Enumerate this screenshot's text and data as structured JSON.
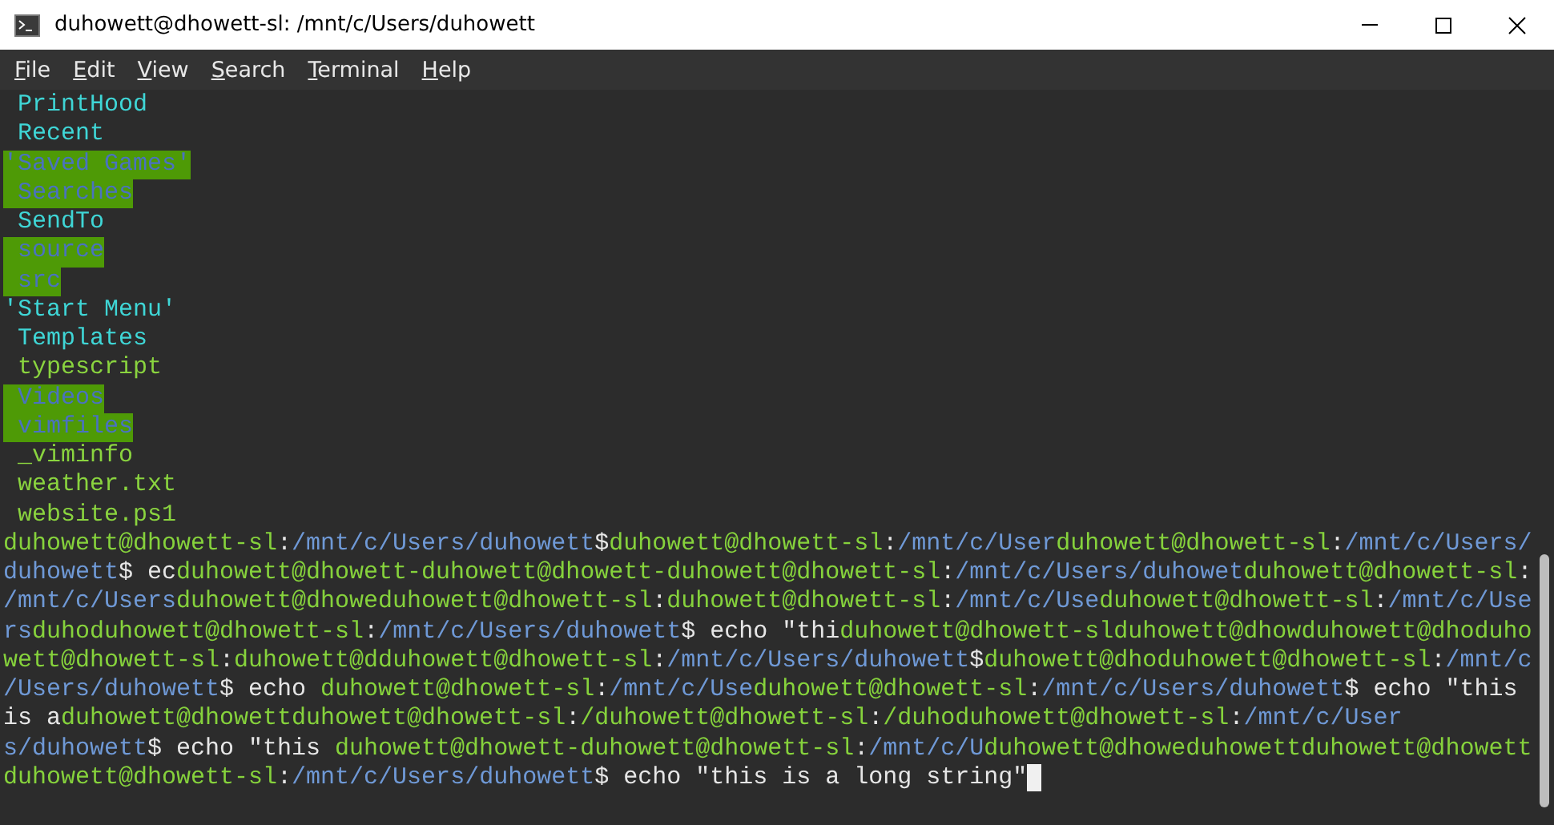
{
  "window": {
    "title": "duhowett@dhowett-sl: /mnt/c/Users/duhowett"
  },
  "menu": [
    {
      "label": "File"
    },
    {
      "label": "Edit"
    },
    {
      "label": "View"
    },
    {
      "label": "Search"
    },
    {
      "label": "Terminal"
    },
    {
      "label": "Help"
    }
  ],
  "listing": [
    {
      "text": " PrintHood",
      "kind": "dir"
    },
    {
      "text": " Recent",
      "kind": "dir"
    },
    {
      "text": "'Saved Games'",
      "kind": "sticky"
    },
    {
      "text": " Searches",
      "kind": "sticky"
    },
    {
      "text": " SendTo",
      "kind": "dir"
    },
    {
      "text": " source",
      "kind": "sticky"
    },
    {
      "text": " src",
      "kind": "sticky"
    },
    {
      "text": "'Start Menu'",
      "kind": "dir"
    },
    {
      "text": " Templates",
      "kind": "dir"
    },
    {
      "text": " typescript",
      "kind": "file"
    },
    {
      "text": " Videos",
      "kind": "sticky"
    },
    {
      "text": " vimfiles",
      "kind": "sticky"
    },
    {
      "text": " _viminfo",
      "kind": "file"
    },
    {
      "text": " weather.txt",
      "kind": "file"
    },
    {
      "text": " website.ps1",
      "kind": "file"
    }
  ],
  "lines": [
    [
      {
        "kind": "user",
        "text": "duhowett@dhowett-sl"
      },
      {
        "kind": "plain",
        "text": ":"
      },
      {
        "kind": "path",
        "text": "/mnt/c/Users/duhowett"
      },
      {
        "kind": "plain",
        "text": "$"
      },
      {
        "kind": "user",
        "text": "duhowett@dhowett-sl"
      },
      {
        "kind": "plain",
        "text": ":"
      },
      {
        "kind": "path",
        "text": "/mnt/c/User"
      },
      {
        "kind": "user",
        "text": "duhowett@dhowett-sl"
      },
      {
        "kind": "plain",
        "text": ":"
      },
      {
        "kind": "path",
        "text": "/mnt/c/Users/"
      }
    ],
    [
      {
        "kind": "path",
        "text": "duhowett"
      },
      {
        "kind": "plain",
        "text": "$ ec"
      },
      {
        "kind": "user",
        "text": "duhowett@dhowett-duhowett@dhowett-duhowett@dhowett-sl"
      },
      {
        "kind": "plain",
        "text": ":"
      },
      {
        "kind": "path",
        "text": "/mnt/c/Users/duhowet"
      },
      {
        "kind": "user",
        "text": "duhowett@dhowett-sl"
      },
      {
        "kind": "plain",
        "text": ":"
      }
    ],
    [
      {
        "kind": "path",
        "text": "/mnt/c/Users"
      },
      {
        "kind": "user",
        "text": "duhowett@dhoweduhowett@dhowett-sl"
      },
      {
        "kind": "plain",
        "text": ":"
      },
      {
        "kind": "user",
        "text": "duhowett@dhowett-sl"
      },
      {
        "kind": "plain",
        "text": ":"
      },
      {
        "kind": "path",
        "text": "/mnt/c/Use"
      },
      {
        "kind": "user",
        "text": "duhowett@dhowett-sl"
      },
      {
        "kind": "plain",
        "text": ":"
      },
      {
        "kind": "path",
        "text": "/mnt/c/Use"
      }
    ],
    [
      {
        "kind": "path",
        "text": "rs"
      },
      {
        "kind": "user",
        "text": "duhoduhowett@dhowett-sl"
      },
      {
        "kind": "plain",
        "text": ":"
      },
      {
        "kind": "path",
        "text": "/mnt/c/Users/duhowett"
      },
      {
        "kind": "plain",
        "text": "$ echo \"thi"
      },
      {
        "kind": "user",
        "text": "duhowett@dhowett-slduhowett@dhowduhowett@dhoduho"
      }
    ],
    [
      {
        "kind": "user",
        "text": "wett@dhowett-sl"
      },
      {
        "kind": "plain",
        "text": ":"
      },
      {
        "kind": "user",
        "text": "duhowett@dduhowett@dhowett-sl"
      },
      {
        "kind": "plain",
        "text": ":"
      },
      {
        "kind": "path",
        "text": "/mnt/c/Users/duhowett"
      },
      {
        "kind": "plain",
        "text": "$"
      },
      {
        "kind": "user",
        "text": "duhowett@dhoduhowett@dhowett-sl"
      },
      {
        "kind": "plain",
        "text": ":"
      },
      {
        "kind": "path",
        "text": "/mnt/c"
      }
    ],
    [
      {
        "kind": "path",
        "text": "/Users/duhowett"
      },
      {
        "kind": "plain",
        "text": "$ echo "
      },
      {
        "kind": "user",
        "text": "duhowett@dhowett-sl"
      },
      {
        "kind": "plain",
        "text": ":"
      },
      {
        "kind": "path",
        "text": "/mnt/c/Use"
      },
      {
        "kind": "user",
        "text": "duhowett@dhowett-sl"
      },
      {
        "kind": "plain",
        "text": ":"
      },
      {
        "kind": "path",
        "text": "/mnt/c/Users/duhowett"
      },
      {
        "kind": "plain",
        "text": "$ echo \"this"
      }
    ],
    [
      {
        "kind": "plain",
        "text": "is a"
      },
      {
        "kind": "user",
        "text": "duhowett@dhowettduhowett@dhowett-sl"
      },
      {
        "kind": "plain",
        "text": ":"
      },
      {
        "kind": "user",
        "text": "/duhowett@dhowett-sl"
      },
      {
        "kind": "plain",
        "text": ":"
      },
      {
        "kind": "user",
        "text": "/duhoduhowett@dhowett-sl"
      },
      {
        "kind": "plain",
        "text": ":"
      },
      {
        "kind": "path",
        "text": "/mnt/c/User"
      }
    ],
    [
      {
        "kind": "path",
        "text": "s/duhowett"
      },
      {
        "kind": "plain",
        "text": "$ echo \"this "
      },
      {
        "kind": "user",
        "text": "duhowett@dhowett-duhowett@dhowett-sl"
      },
      {
        "kind": "plain",
        "text": ":"
      },
      {
        "kind": "path",
        "text": "/mnt/c/U"
      },
      {
        "kind": "user",
        "text": "duhowett@dhoweduhowettduhowett@dhowett"
      }
    ],
    [
      {
        "kind": "user",
        "text": "duhowett@dhowett-sl"
      },
      {
        "kind": "plain",
        "text": ":"
      },
      {
        "kind": "path",
        "text": "/mnt/c/Users/duhowett"
      },
      {
        "kind": "plain",
        "text": "$ echo \"this is a long string\""
      }
    ]
  ]
}
